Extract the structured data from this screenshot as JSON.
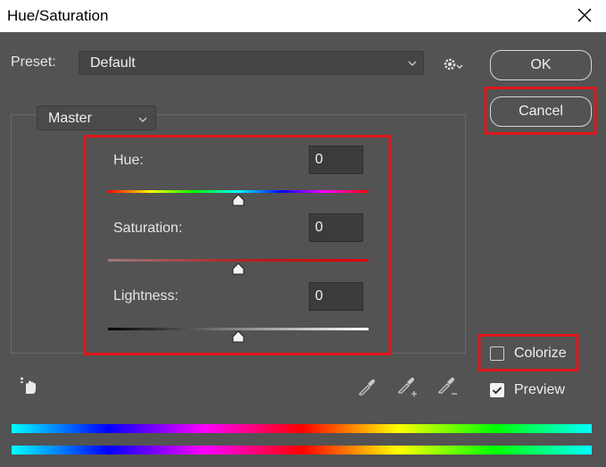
{
  "window": {
    "title": "Hue/Saturation"
  },
  "preset": {
    "label": "Preset:",
    "value": "Default"
  },
  "buttons": {
    "ok": "OK",
    "cancel": "Cancel"
  },
  "channel": {
    "value": "Master"
  },
  "sliders": {
    "hue": {
      "label": "Hue:",
      "value": "0",
      "position": 0.5
    },
    "saturation": {
      "label": "Saturation:",
      "value": "0",
      "position": 0.5
    },
    "lightness": {
      "label": "Lightness:",
      "value": "0",
      "position": 0.5
    }
  },
  "options": {
    "colorize": {
      "label": "Colorize",
      "checked": false
    },
    "preview": {
      "label": "Preview",
      "checked": true
    }
  },
  "icons": {
    "close": "close-icon",
    "gear": "gear-icon",
    "hand": "targeted-adjustment-hand-icon",
    "eyedroppers": [
      "eyedropper-icon",
      "eyedropper-plus-icon",
      "eyedropper-minus-icon"
    ]
  },
  "colors": {
    "highlight": "#e0161b",
    "panel": "#535353"
  }
}
